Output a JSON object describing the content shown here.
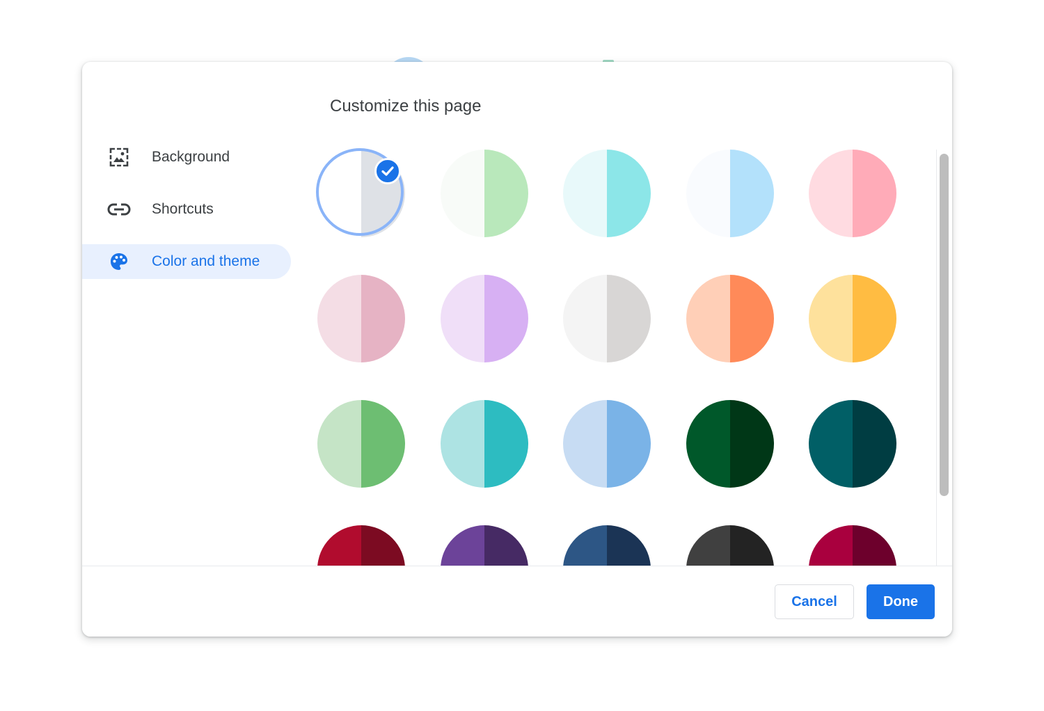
{
  "dialog": {
    "title": "Customize this page"
  },
  "sidebar": {
    "items": [
      {
        "label": "Background",
        "icon": "background-icon",
        "active": false
      },
      {
        "label": "Shortcuts",
        "icon": "link-icon",
        "active": false
      },
      {
        "label": "Color and theme",
        "icon": "palette-icon",
        "active": true
      }
    ]
  },
  "themes": [
    {
      "left": "#ffffff",
      "right": "#dee1e6",
      "selected": true
    },
    {
      "left": "#f8fbf8",
      "right": "#b9e8bb",
      "selected": false
    },
    {
      "left": "#e8f9fa",
      "right": "#8ce6e8",
      "selected": false
    },
    {
      "left": "#f9fbfe",
      "right": "#b3e1fb",
      "selected": false
    },
    {
      "left": "#ffdbe1",
      "right": "#ffabb8",
      "selected": false
    },
    {
      "left": "#f4dde5",
      "right": "#e6b3c4",
      "selected": false
    },
    {
      "left": "#f0dff8",
      "right": "#d7b0f3",
      "selected": false
    },
    {
      "left": "#f4f4f4",
      "right": "#d8d6d5",
      "selected": false
    },
    {
      "left": "#ffcfb7",
      "right": "#ff8a59",
      "selected": false
    },
    {
      "left": "#fee19c",
      "right": "#ffbc42",
      "selected": false
    },
    {
      "left": "#c5e4c6",
      "right": "#6dbe72",
      "selected": false
    },
    {
      "left": "#ade3e3",
      "right": "#2dbcc1",
      "selected": false
    },
    {
      "left": "#c7dcf3",
      "right": "#7ab3e7",
      "selected": false
    },
    {
      "left": "#00582a",
      "right": "#003717",
      "selected": false
    },
    {
      "left": "#015f66",
      "right": "#003d42",
      "selected": false
    },
    {
      "left": "#b10c2e",
      "right": "#7c0b22",
      "selected": false
    },
    {
      "left": "#6c4399",
      "right": "#462a64",
      "selected": false
    },
    {
      "left": "#2d5685",
      "right": "#1b3455",
      "selected": false
    },
    {
      "left": "#404040",
      "right": "#232323",
      "selected": false
    },
    {
      "left": "#a9003e",
      "right": "#6d002c",
      "selected": false
    }
  ],
  "footer": {
    "cancel_label": "Cancel",
    "done_label": "Done"
  }
}
